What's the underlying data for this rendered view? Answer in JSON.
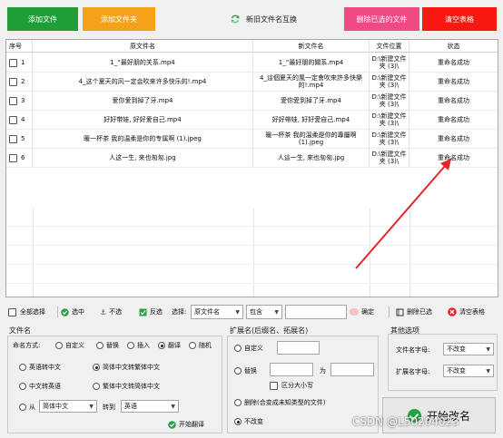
{
  "toolbar": {
    "add_files": "添加文件",
    "add_folder": "添加文件夹",
    "swap_names": "新旧文件名互换",
    "delete_selected": "删除已选的文件",
    "clear_table": "清空表格",
    "colors": {
      "green": "#1f9e38",
      "orange": "#f5a21b",
      "pink": "#ef4a84",
      "red": "#f81a10"
    }
  },
  "table": {
    "headers": {
      "index": "序号",
      "original": "原文件名",
      "new": "新文件名",
      "location": "文件位置",
      "status": "状态"
    },
    "rows": [
      {
        "index": "1",
        "original": "1_“最好朋的关系.mp4",
        "new": "1_“最好朋的關系.mp4",
        "location": "D:\\新建文件夹 (3)\\",
        "status": "重命名成功"
      },
      {
        "index": "2",
        "original": "4_这个夏天的风一定会吹来许多快乐的!.mp4",
        "new": "4_這個夏天的風一定會吹來許多快樂的!.mp4",
        "location": "D:\\新建文件夹 (3)\\",
        "status": "重命名成功"
      },
      {
        "index": "3",
        "original": "爱你爱到掉了牙.mp4",
        "new": "愛你愛到掉了牙.mp4",
        "location": "D:\\新建文件夹 (3)\\",
        "status": "重命名成功"
      },
      {
        "index": "4",
        "original": "好好带娃, 好好爱自己.mp4",
        "new": "好好帶娃, 好好愛自己.mp4",
        "location": "D:\\新建文件夹 (3)\\",
        "status": "重命名成功"
      },
      {
        "index": "5",
        "original": "暖一杯茶 我的温柔是你的专属啊 (1).jpeg",
        "new": "暖一杯茶 我的溫柔是你的專屬啊 (1).jpeg",
        "location": "D:\\新建文件夹 (3)\\",
        "status": "重命名成功"
      },
      {
        "index": "6",
        "original": "人这一生, 来也匆匆.jpg",
        "new": "人這一生, 來也匆匆.jpg",
        "location": "D:\\新建文件夹 (3)\\",
        "status": "重命名成功"
      }
    ]
  },
  "selection": {
    "select_all": "全部选择",
    "select_mid": "选中",
    "unselect": "不选",
    "invert": "反选",
    "select_label": "选择:",
    "field_value": "原文件名",
    "match_value": "包含",
    "confirm": "确定",
    "delete_selected": "删除已选",
    "clear_table": "清空表格"
  },
  "filename_panel": {
    "title": "文件名",
    "mode_label": "命名方式:",
    "modes": [
      "自定义",
      "替换",
      "插入",
      "翻译",
      "随机"
    ],
    "selected_mode": "翻译",
    "options": [
      "英语转中文",
      "简体中文转繁体中文",
      "中文转英语",
      "繁体中文转简体中文"
    ],
    "selected_option": "简体中文转繁体中文",
    "from_label": "从",
    "from_value": "简体中文",
    "to_label": "转到",
    "to_value": "英语",
    "start_translate": "开始翻译"
  },
  "extension_panel": {
    "title": "扩展名(后缀名、拓展名)",
    "custom": "自定义",
    "replace": "替换",
    "replace_with": "为",
    "case_sensitive": "区分大小写",
    "delete": "删除(合变成未知类型的文件)",
    "unchanged": "不改变"
  },
  "other_panel": {
    "title": "其他选项",
    "name_case_label": "文件名字母:",
    "name_case_value": "不改变",
    "ext_case_label": "扩展名字母:",
    "ext_case_value": "不改变"
  },
  "start_button": "开始改名",
  "watermark": "CSDN @L50204023",
  "arrow_color": "#e3262b"
}
